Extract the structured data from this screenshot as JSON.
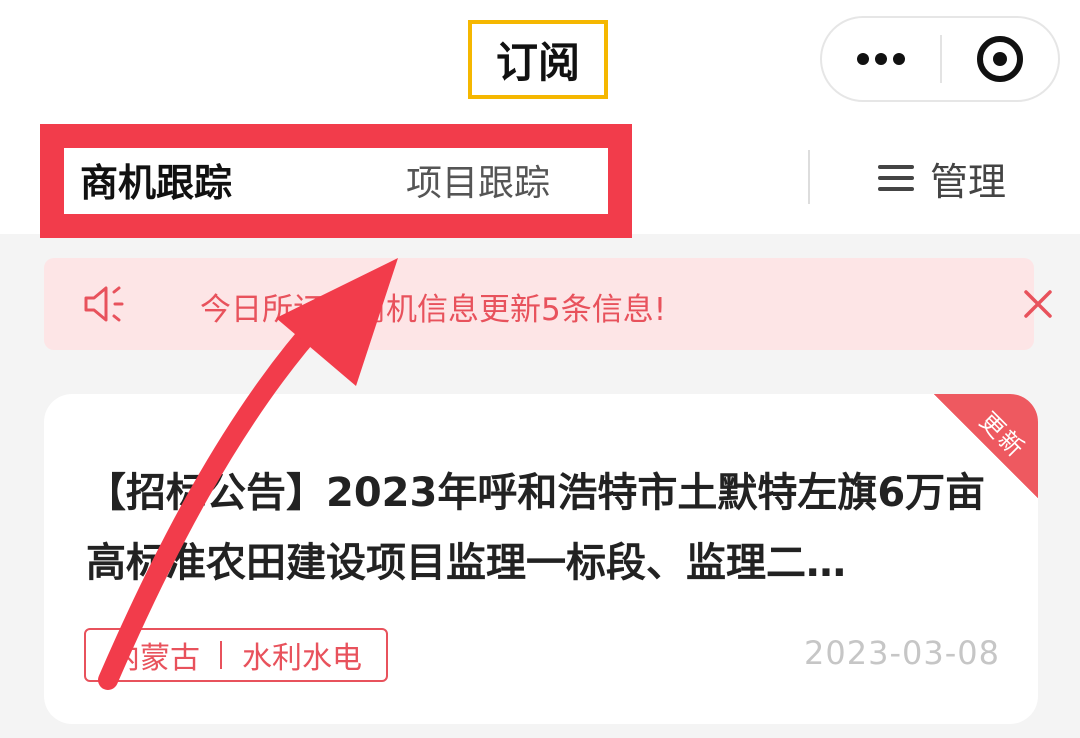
{
  "header": {
    "title": "订阅"
  },
  "tabs": {
    "active_label": "商机跟踪",
    "inactive_label": "项目跟踪",
    "manage_label": "管理"
  },
  "notice": {
    "text": "今日所订阅商机信息更新5条信息!"
  },
  "card": {
    "badge": "更新",
    "title": "【招标公告】2023年呼和浩特市土默特左旗6万亩高标准农田建设项目监理一标段、监理二…",
    "region": "内蒙古",
    "category": "水利水电",
    "date": "2023-03-08"
  },
  "colors": {
    "accent_red": "#f23c4b",
    "highlight_yellow": "#f5b700",
    "notice_bg": "#fde5e6"
  }
}
